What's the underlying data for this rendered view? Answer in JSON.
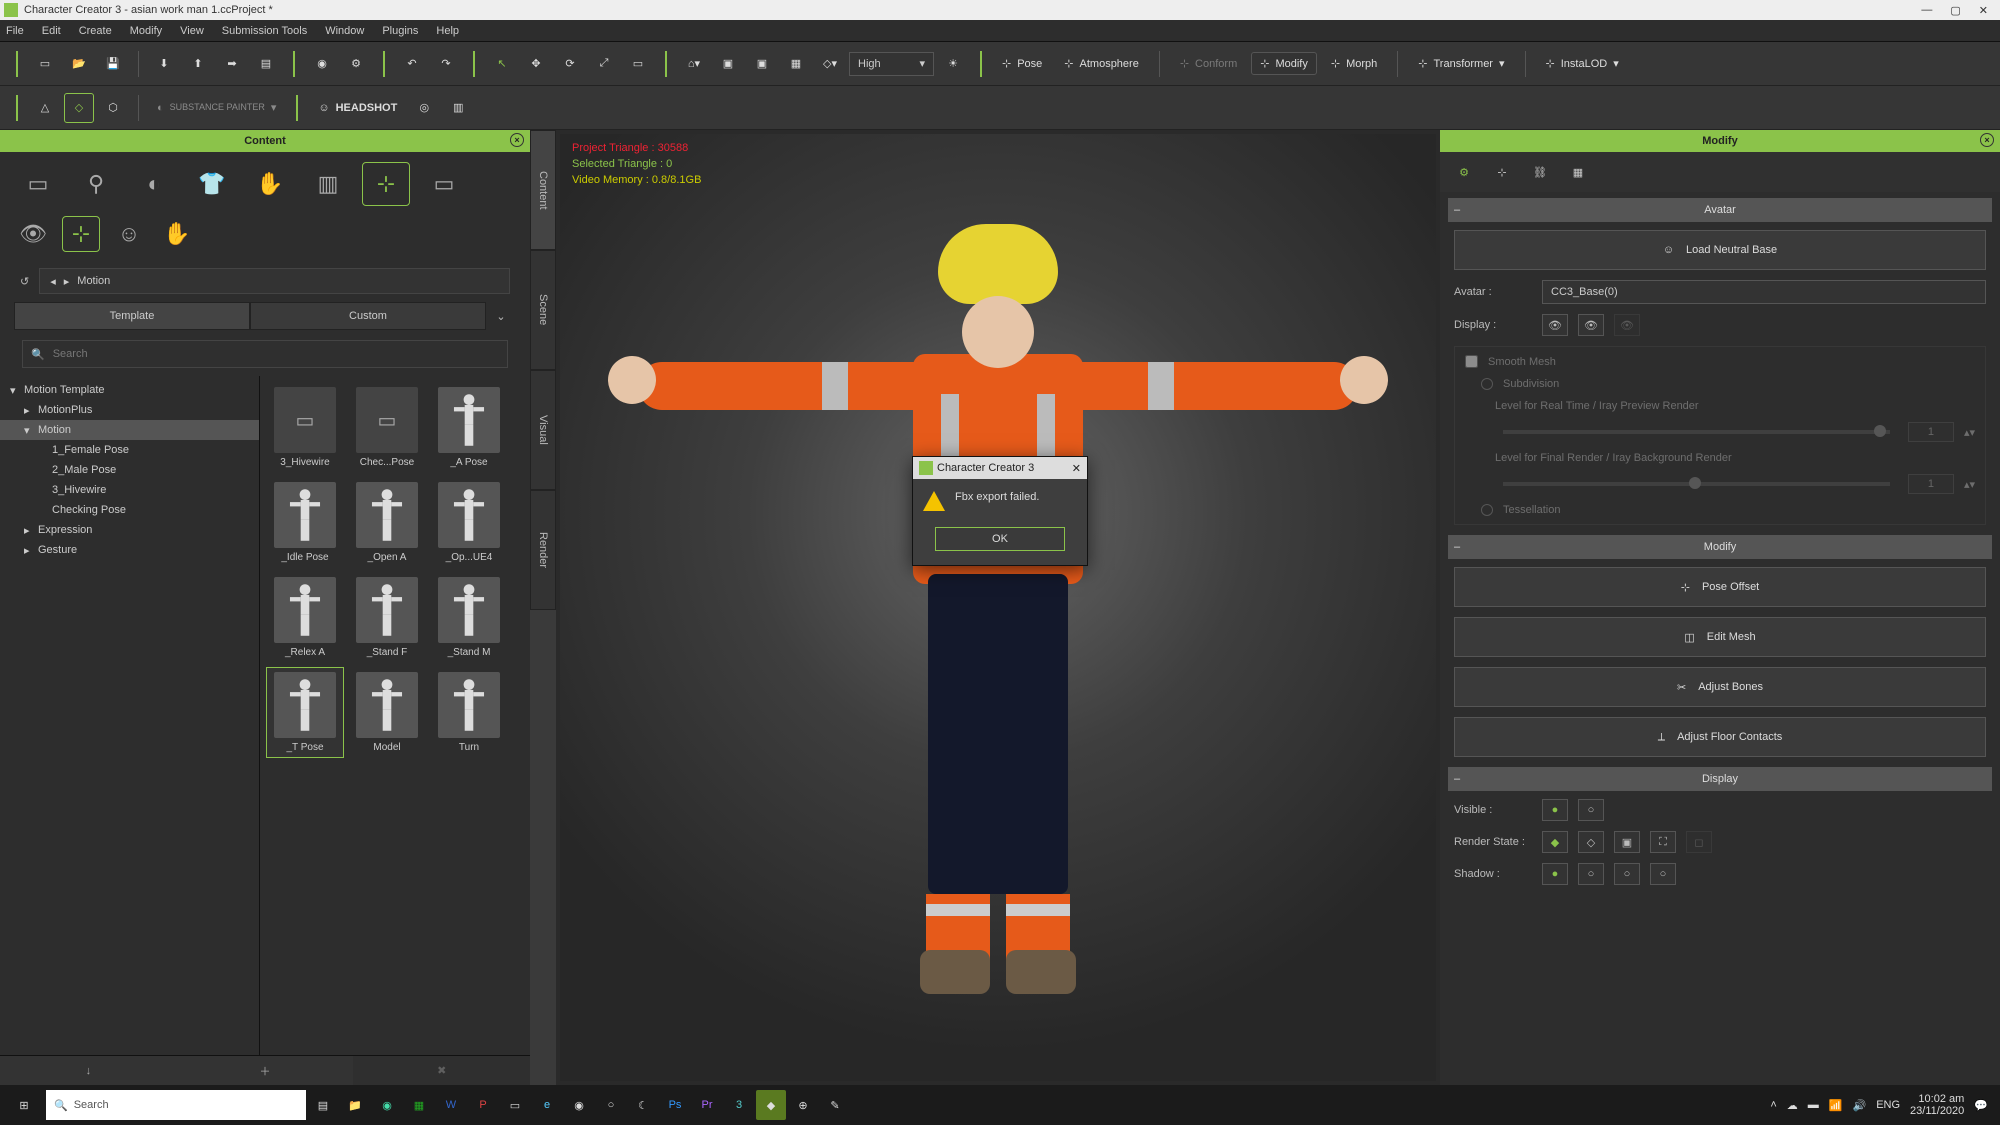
{
  "colors": {
    "accent": "#8bc34a",
    "orange": "#e65a1a",
    "helmet": "#e6d332"
  },
  "title": "Character Creator 3 - asian work man 1.ccProject *",
  "menu": [
    "File",
    "Edit",
    "Create",
    "Modify",
    "View",
    "Submission Tools",
    "Window",
    "Plugins",
    "Help"
  ],
  "toolbar": {
    "quality": "High",
    "right_actions": [
      {
        "icon": "pose",
        "label": "Pose"
      },
      {
        "icon": "atmo",
        "label": "Atmosphere"
      },
      {
        "icon": "conf",
        "label": "Conform",
        "dim": true
      },
      {
        "icon": "mod",
        "label": "Modify",
        "boxed": true
      },
      {
        "icon": "morph",
        "label": "Morph"
      },
      {
        "icon": "trans",
        "label": "Transformer",
        "caret": true
      },
      {
        "icon": "insta",
        "label": "InstaLOD",
        "caret": true
      }
    ],
    "headshot": "HEADSHOT",
    "substance": "SUBSTANCE PAINTER"
  },
  "content": {
    "header": "Content",
    "breadcrumb": "Motion",
    "tabs": [
      "Template",
      "Custom"
    ],
    "active_tab": 0,
    "search_placeholder": "Search",
    "tree": [
      {
        "label": "Motion Template",
        "level": 0,
        "open": true
      },
      {
        "label": "MotionPlus",
        "level": 1,
        "open": false
      },
      {
        "label": "Motion",
        "level": 1,
        "open": true,
        "sel": true
      },
      {
        "label": "1_Female Pose",
        "level": 2
      },
      {
        "label": "2_Male Pose",
        "level": 2
      },
      {
        "label": "3_Hivewire",
        "level": 2
      },
      {
        "label": "Checking Pose",
        "level": 2
      },
      {
        "label": "Expression",
        "level": 1,
        "open": false
      },
      {
        "label": "Gesture",
        "level": 1,
        "open": false
      }
    ],
    "grid": [
      {
        "label": "3_Hivewire",
        "folder": true
      },
      {
        "label": "Chec...Pose",
        "folder": true
      },
      {
        "label": "_A Pose"
      },
      {
        "label": "_Idle Pose"
      },
      {
        "label": "_Open A"
      },
      {
        "label": "_Op...UE4"
      },
      {
        "label": "_Relex A"
      },
      {
        "label": "_Stand F"
      },
      {
        "label": "_Stand M"
      },
      {
        "label": "_T Pose",
        "sel": true
      },
      {
        "label": "Model"
      },
      {
        "label": "Turn"
      }
    ]
  },
  "side_tabs": [
    "Content",
    "Scene",
    "Visual",
    "Render"
  ],
  "viewport_stats": {
    "line1": "Project Triangle : 30588",
    "line2": "Selected Triangle : 0",
    "line3": "Video Memory : 0.8/8.1GB"
  },
  "dialog": {
    "title": "Character Creator 3",
    "message": "Fbx export failed.",
    "ok": "OK"
  },
  "modify": {
    "header": "Modify",
    "avatar_section": "Avatar",
    "load_neutral": "Load Neutral Base",
    "avatar_label": "Avatar :",
    "avatar_value": "CC3_Base(0)",
    "display_label": "Display :",
    "smooth": "Smooth Mesh",
    "subdiv": "Subdivision",
    "rt_label": "Level for Real Time / Iray Preview Render",
    "final_label": "Level for Final Render / Iray Background Render",
    "rt_val": "1",
    "final_val": "1",
    "tess": "Tessellation",
    "modify_section": "Modify",
    "pose_offset": "Pose Offset",
    "edit_mesh": "Edit Mesh",
    "adjust_bones": "Adjust Bones",
    "adjust_floor": "Adjust Floor Contacts",
    "display_section": "Display",
    "visible": "Visible :",
    "render_state": "Render State :",
    "shadow": "Shadow :"
  },
  "taskbar": {
    "search_placeholder": "Search",
    "lang": "ENG",
    "time": "10:02 am",
    "date": "23/11/2020"
  }
}
